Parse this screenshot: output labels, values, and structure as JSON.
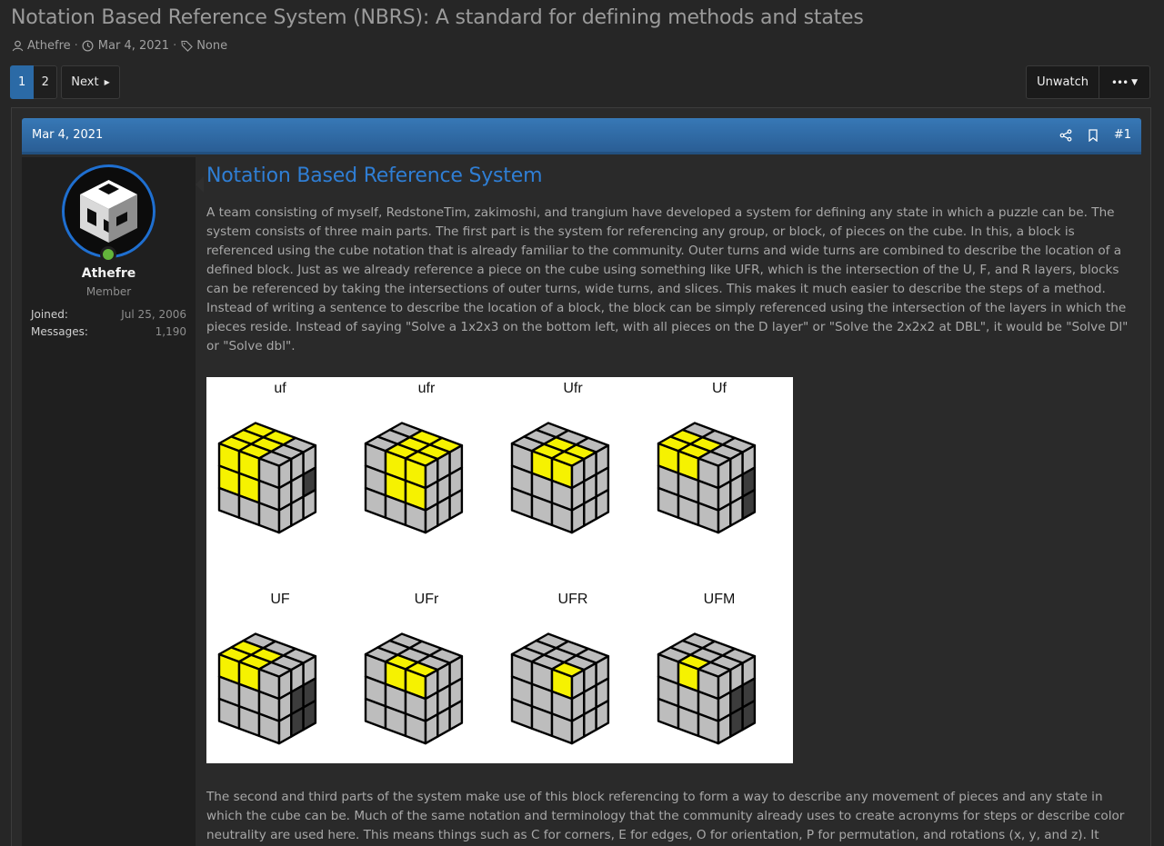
{
  "thread": {
    "title": "Notation Based Reference System (NBRS): A standard for defining methods and states",
    "author": "Athefre",
    "date": "Mar 4, 2021",
    "tags": "None"
  },
  "pagination": {
    "pages": [
      "1",
      "2"
    ],
    "current": "1",
    "next_label": "Next"
  },
  "actions": {
    "unwatch_label": "Unwatch",
    "more_label": "•••"
  },
  "post": {
    "date": "Mar 4, 2021",
    "number": "#1",
    "title": "Notation Based Reference System",
    "paragraph1": "A team consisting of myself, RedstoneTim, zakimoshi, and trangium have developed a system for defining any state in which a puzzle can be. The system consists of three main parts. The first part is the system for referencing any group, or block, of pieces on the cube. In this, a block is referenced using the cube notation that is already familiar to the community. Outer turns and wide turns are combined to describe the location of a defined block. Just as we already reference a piece on the cube using something like UFR, which is the intersection of the U, F, and R layers, blocks can be referenced by taking the intersections of outer turns, wide turns, and slices. This makes it much easier to describe the steps of a method. Instead of writing a sentence to describe the location of a block, the block can be simply referenced using the intersection of the layers in which the pieces reside. Instead of saying \"Solve a 1x2x3 on the bottom left, with all pieces on the D layer\" or \"Solve the 2x2x2 at DBL\", it would be \"Solve Dl\" or \"Solve dbl\".",
    "paragraph2": "The second and third parts of the system make use of this block referencing to form a way to describe any movement of pieces and any state in which the cube can be. Much of the same notation and terminology that the community already uses to create acronyms for steps or describe color neutrality are used here. This means things such as C for corners, E for edges, O for orientation, P for permutation, and rotations (x, y, and z). It works in this way:",
    "figure_labels": [
      "uf",
      "ufr",
      "Ufr",
      "Uf",
      "UF",
      "UFr",
      "UFR",
      "UFM"
    ]
  },
  "user": {
    "name": "Athefre",
    "title": "Member",
    "joined_label": "Joined:",
    "joined": "Jul 25, 2006",
    "messages_label": "Messages:",
    "messages": "1,190"
  },
  "colors": {
    "background": "#262626",
    "accent": "#2b6aa6",
    "link": "#2f7ed4",
    "highlight_sticker": "#f6f200",
    "grey_sticker": "#bdbdbd",
    "dark_sticker": "#3c3c3c",
    "online": "#63b53b"
  },
  "icons": {
    "author": "user-icon",
    "date": "clock-icon",
    "tags": "tag-icon",
    "share": "share-icon",
    "bookmark": "bookmark-icon"
  }
}
